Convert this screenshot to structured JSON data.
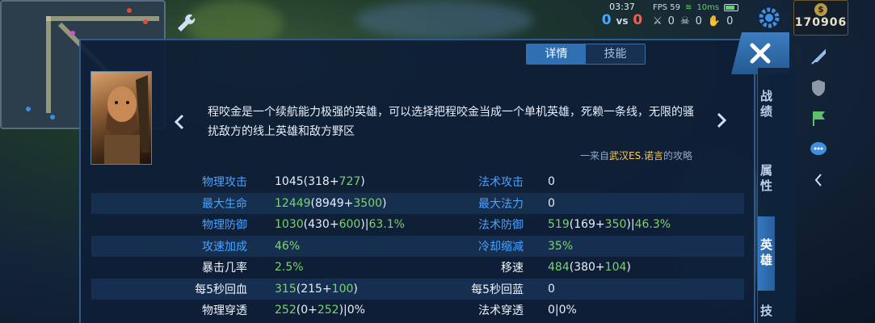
{
  "hud": {
    "time": "03:37",
    "score_blue": "0",
    "score_vs": "vs",
    "score_red": "0",
    "fps_label": "FPS 59",
    "ping": "10ms",
    "kills": "0",
    "deaths": "0",
    "assists": "0",
    "gold_amount": "170906"
  },
  "tabs": [
    {
      "label": "详情",
      "active": true
    },
    {
      "label": "技能",
      "active": false
    }
  ],
  "side_tabs": [
    {
      "label": "战绩",
      "active": false
    },
    {
      "label": "属性",
      "active": false
    },
    {
      "label": "英雄",
      "active": true
    },
    {
      "label": "技",
      "active": false
    }
  ],
  "hero": {
    "description": "程咬金是一个续航能力极强的英雄，可以选择把程咬金当成一个单机英雄，死赖一条线，无限的骚扰敌方的线上英雄和敌方野区",
    "credit_prefix": "一来自",
    "credit_name": "武汉ES.诺言",
    "credit_suffix": "的攻略"
  },
  "stats": [
    {
      "l1": "物理攻击",
      "l1_color": "blue",
      "v1": [
        [
          "w",
          "1045("
        ],
        [
          "w",
          "318+"
        ],
        [
          "g",
          "727"
        ],
        [
          "w",
          ")"
        ]
      ],
      "l2": "法术攻击",
      "l2_color": "blue",
      "v2": [
        [
          "w",
          "0"
        ]
      ]
    },
    {
      "l1": "最大生命",
      "l1_color": "blue",
      "v1": [
        [
          "g",
          "12449"
        ],
        [
          "w",
          "(8949+"
        ],
        [
          "g",
          "3500"
        ],
        [
          "w",
          ")"
        ]
      ],
      "l2": "最大法力",
      "l2_color": "blue",
      "v2": [
        [
          "w",
          "0"
        ]
      ]
    },
    {
      "l1": "物理防御",
      "l1_color": "blue",
      "v1": [
        [
          "g",
          "1030"
        ],
        [
          "w",
          "(430+"
        ],
        [
          "g",
          "600"
        ],
        [
          "w",
          ")|"
        ],
        [
          "g",
          "63.1%"
        ]
      ],
      "l2": "法术防御",
      "l2_color": "blue",
      "v2": [
        [
          "g",
          "519"
        ],
        [
          "w",
          "(169+"
        ],
        [
          "g",
          "350"
        ],
        [
          "w",
          ")|"
        ],
        [
          "g",
          "46.3%"
        ]
      ]
    },
    {
      "l1": "攻速加成",
      "l1_color": "blue",
      "v1": [
        [
          "g",
          "46%"
        ]
      ],
      "l2": "冷却缩减",
      "l2_color": "blue",
      "v2": [
        [
          "g",
          "35%"
        ]
      ]
    },
    {
      "l1": "暴击几率",
      "l1_color": "white",
      "v1": [
        [
          "g",
          "2.5%"
        ]
      ],
      "l2": "移速",
      "l2_color": "white",
      "v2": [
        [
          "g",
          "484"
        ],
        [
          "w",
          "(380+"
        ],
        [
          "g",
          "104"
        ],
        [
          "w",
          ")"
        ]
      ]
    },
    {
      "l1": "每5秒回血",
      "l1_color": "white",
      "v1": [
        [
          "g",
          "315"
        ],
        [
          "w",
          "(215+"
        ],
        [
          "g",
          "100"
        ],
        [
          "w",
          ")"
        ]
      ],
      "l2": "每5秒回蓝",
      "l2_color": "white",
      "v2": [
        [
          "w",
          "0"
        ]
      ]
    },
    {
      "l1": "物理穿透",
      "l1_color": "white",
      "v1": [
        [
          "g",
          "252"
        ],
        [
          "w",
          "(0+"
        ],
        [
          "g",
          "252"
        ],
        [
          "w",
          ")|0%"
        ]
      ],
      "l2": "法术穿透",
      "l2_color": "white",
      "v2": [
        [
          "w",
          "0|0%"
        ]
      ]
    }
  ]
}
